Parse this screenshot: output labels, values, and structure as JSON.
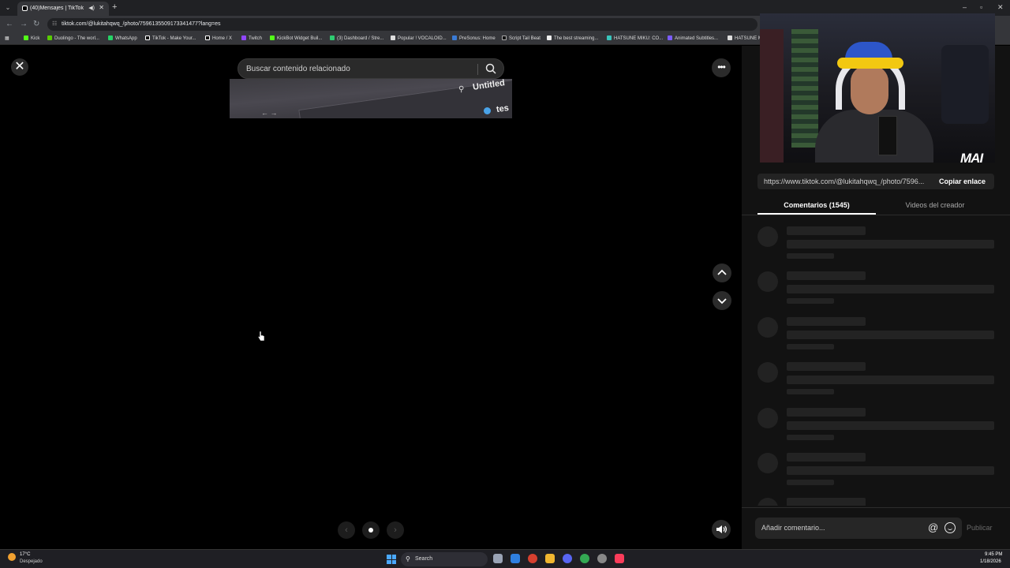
{
  "browser": {
    "tab_title": "(40)Mensajes | TikTok",
    "address": "tiktok.com/@lukitahqwq_/photo/7596135509173341477?lang=es",
    "bookmarks": [
      {
        "label": "Kick",
        "color": "#53fc18"
      },
      {
        "label": "Duolingo - The worl...",
        "color": "#58cc02"
      },
      {
        "label": "WhatsApp",
        "color": "#25d366"
      },
      {
        "label": "TikTok - Make Your...",
        "color": "#111111"
      },
      {
        "label": "Home / X",
        "color": "#111111"
      },
      {
        "label": "Twitch",
        "color": "#9146ff"
      },
      {
        "label": "KickBot Widget Buil...",
        "color": "#53fc18"
      },
      {
        "label": "(3) Dashboard / Stre...",
        "color": "#2ecc71"
      },
      {
        "label": "Popular ! VOCALOID...",
        "color": "#dddddd"
      },
      {
        "label": "PreSonus: Home",
        "color": "#3a7bd5"
      },
      {
        "label": "Script Tail Beat",
        "color": "#111111"
      },
      {
        "label": "The best streaming...",
        "color": "#eeeeee"
      },
      {
        "label": "HATSUNE MIKU: CO...",
        "color": "#39c5bb"
      },
      {
        "label": "Animated Subtitles...",
        "color": "#7b5cff"
      },
      {
        "label": "HATSUNE M",
        "color": "#dddddd"
      }
    ]
  },
  "viewer": {
    "search_placeholder": "Buscar contenido relacionado",
    "preview_title": "Untitled",
    "preview_text": "tes",
    "more_icon": "•••"
  },
  "side_panel": {
    "link_url": "https://www.tiktok.com/@lukitahqwq_/photo/7596...",
    "copy_link_label": "Copiar enlace",
    "tabs": {
      "comments": "Comentarios (1545)",
      "creator_videos": "Videos del creador"
    },
    "comment_placeholder": "Añadir comentario...",
    "publish_label": "Publicar",
    "mention_symbol": "@",
    "webcam_logo": "MAI"
  },
  "taskbar": {
    "weather_temp": "17°C",
    "weather_desc": "Despejado",
    "search_label": "Search",
    "time": "9:45 PM",
    "date": "1/18/2026"
  },
  "colors": {
    "accent": "#ffffff",
    "background": "#000000",
    "panel": "#121212"
  }
}
